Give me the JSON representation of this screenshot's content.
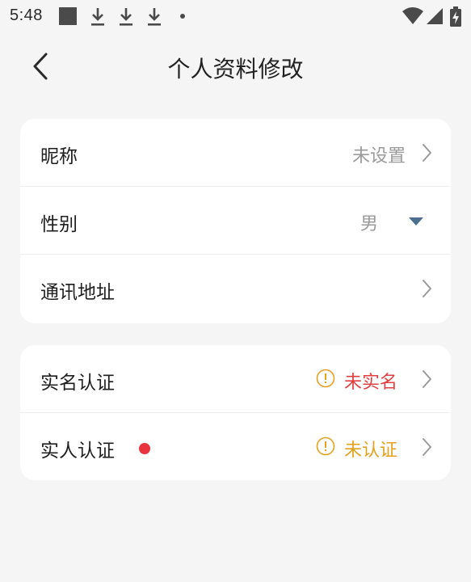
{
  "status_bar": {
    "time": "5:48"
  },
  "header": {
    "title": "个人资料修改"
  },
  "profile_card": {
    "nickname": {
      "label": "昵称",
      "value": "未设置"
    },
    "gender": {
      "label": "性别",
      "value": "男"
    },
    "address": {
      "label": "通讯地址"
    }
  },
  "verify_card": {
    "real_name": {
      "label": "实名认证",
      "status": "未实名"
    },
    "real_person": {
      "label": "实人认证",
      "status": "未认证"
    }
  },
  "colors": {
    "background": "#f5f5f5",
    "card": "#ffffff",
    "status_red": "#e04040",
    "status_orange": "#e6a01e",
    "dot_red": "#e8343f",
    "dropdown_arrow": "#4c6f8f"
  }
}
